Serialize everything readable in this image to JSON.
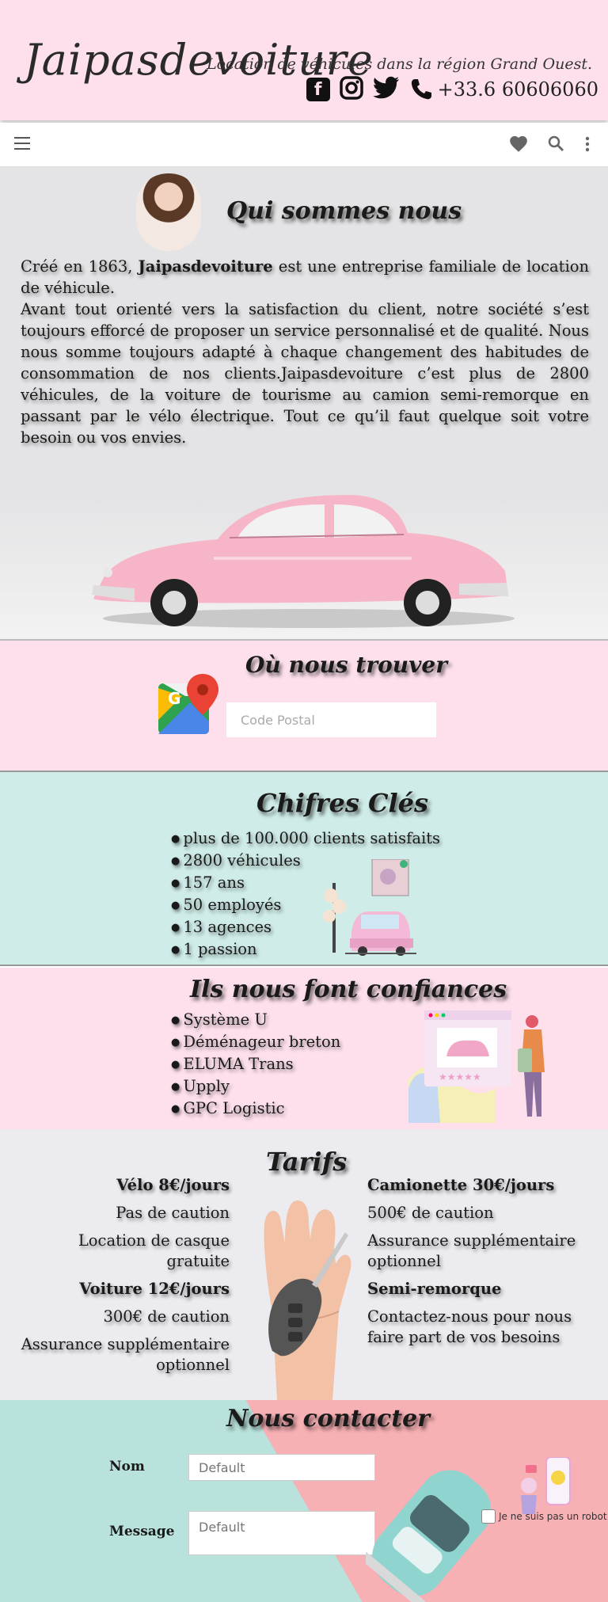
{
  "header": {
    "logo": "Jaipasdevoiture",
    "tagline": "Location de véhicules dans la région Grand Ouest.",
    "phone": "+33.6 60606060",
    "social_icons": [
      "facebook-icon",
      "instagram-icon",
      "twitter-icon",
      "phone-icon"
    ]
  },
  "toolbar": {
    "icons": [
      "menu-icon",
      "heart-icon",
      "search-icon",
      "more-vert-icon"
    ]
  },
  "about": {
    "title": "Qui sommes nous",
    "intro_before": "Créé en 1863, ",
    "intro_brand": "Jaipasdevoiture",
    "intro_after": " est une entreprise familiale de location de véhicule.",
    "body": "Avant tout orienté vers la satisfaction du client, notre société s’est toujours efforcé de proposer un service personnalisé et de qualité. Nous nous somme toujours adapté à chaque changement des habitudes de consommation de nos clients.Jaipasdevoiture c’est plus de 2800 véhicules, de la voiture de tourisme au camion semi-remorque en passant par le vélo électrique. Tout ce qu’il faut quelque soit votre besoin ou vos envies."
  },
  "map": {
    "title": "Où nous trouver",
    "postal_placeholder": "Code Postal"
  },
  "figures": {
    "title": "Chifres Clés",
    "items": [
      "plus de 100.000 clients satisfaits",
      "2800 véhicules",
      "157 ans",
      "50 employés",
      "13 agences",
      "1 passion"
    ]
  },
  "trust": {
    "title": "Ils nous font confiances",
    "items": [
      "Système U",
      "Déménageur breton",
      "ELUMA Trans",
      "Upply",
      "GPC Logistic"
    ]
  },
  "tarifs": {
    "title": "Tarifs",
    "left": {
      "velo": "Vélo 8€/jours",
      "velo_caution": "Pas de caution",
      "velo_extra": "Location de casque gratuite",
      "voiture": "Voiture 12€/jours",
      "voiture_caution": "300€ de caution",
      "voiture_extra": "Assurance supplémentaire optionnel"
    },
    "right": {
      "camionette": "Camionette 30€/jours",
      "camionette_caution": "500€ de caution",
      "camionette_extra": "Assurance supplémentaire optionnel",
      "semi": "Semi-remorque",
      "semi_text": "Contactez-nous pour nous faire part de vos besoins"
    }
  },
  "contact": {
    "title": "Nous contacter",
    "nom_label": "Nom",
    "message_label": "Message",
    "nom_placeholder": "Default",
    "message_placeholder": "Default",
    "robot_label": "Je ne suis pas un robot"
  },
  "colors": {
    "pink": "#fde0ec",
    "mint": "#cfece8",
    "grey": "#e4e4e6"
  }
}
